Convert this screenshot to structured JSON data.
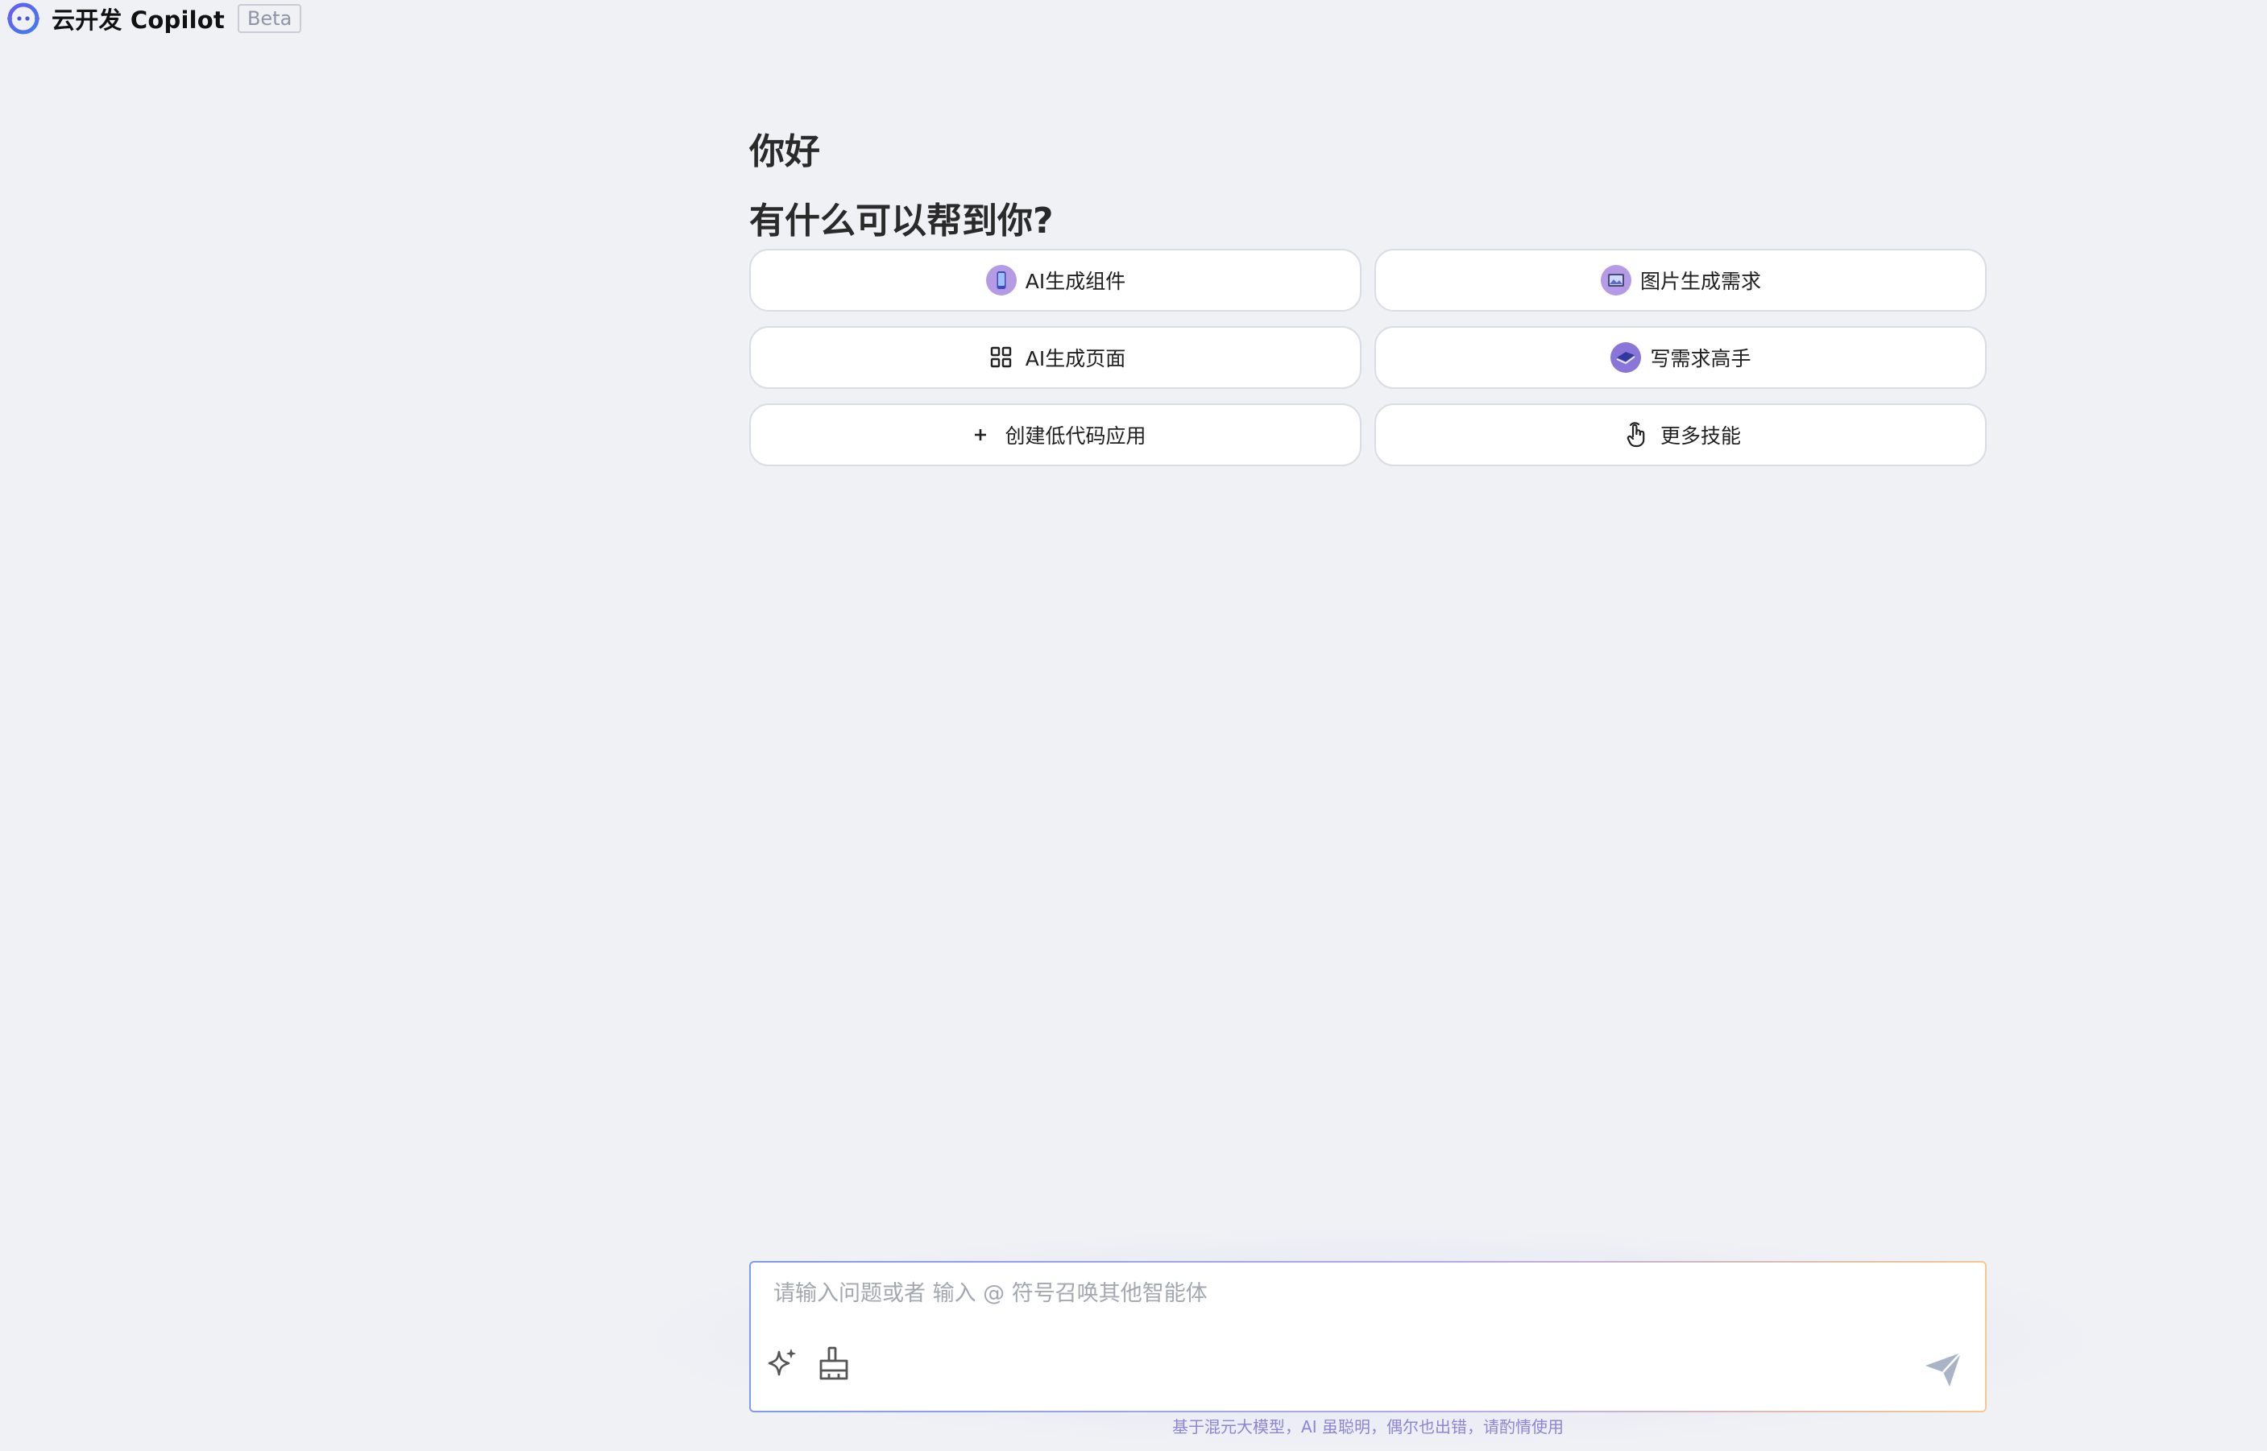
{
  "header": {
    "title": "云开发 Copilot",
    "badge": "Beta",
    "logo_icon": "copilot-face-icon"
  },
  "greeting": {
    "hello": "你好",
    "prompt": "有什么可以帮到你?"
  },
  "skills": [
    {
      "label": "AI生成组件",
      "icon": "phone-component-icon"
    },
    {
      "label": "图片生成需求",
      "icon": "image-icon"
    },
    {
      "label": "AI生成页面",
      "icon": "grid-icon"
    },
    {
      "label": "写需求高手",
      "icon": "book-icon"
    },
    {
      "label": "创建低代码应用",
      "icon": "plus-icon"
    },
    {
      "label": "更多技能",
      "icon": "hand-pointer-icon"
    }
  ],
  "composer": {
    "placeholder": "请输入问题或者 输入 @ 符号召唤其他智能体",
    "value": ""
  },
  "disclaimer": "基于混元大模型，AI 虽聪明，偶尔也出错，请酌情使用",
  "colors": {
    "background": "#f0f1f5",
    "accent": "#5b5bd6",
    "disclaimer": "#8b86d6"
  }
}
